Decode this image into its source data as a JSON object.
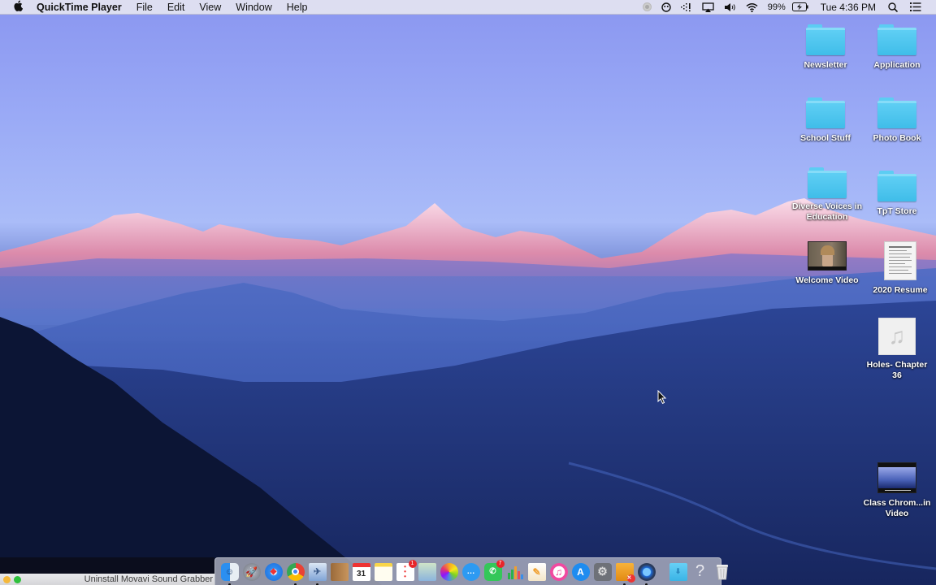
{
  "menubar": {
    "apple_icon": "apple-logo-icon",
    "app_name": "QuickTime Player",
    "menus": [
      "File",
      "Edit",
      "View",
      "Window",
      "Help"
    ],
    "status": {
      "icons": [
        "record-indicator-icon",
        "face-status-icon",
        "bluetooth-signal-icon",
        "airplay-icon",
        "volume-icon",
        "wifi-icon"
      ],
      "battery_percent": "99%",
      "battery_icon": "battery-charging-icon",
      "clock": "Tue 4:36 PM",
      "spotlight_icon": "search-icon",
      "notification_icon": "notification-center-icon"
    }
  },
  "desktop": {
    "icons": [
      {
        "label": "Newsletter",
        "type": "folder"
      },
      {
        "label": "Application",
        "type": "folder"
      },
      {
        "label": "School Stuff",
        "type": "folder"
      },
      {
        "label": "Photo Book",
        "type": "folder"
      },
      {
        "label": "Diverse Voices in Education",
        "type": "folder"
      },
      {
        "label": "TpT Store",
        "type": "folder"
      },
      {
        "label": "Welcome Video",
        "type": "video"
      },
      {
        "label": "2020 Resume",
        "type": "document"
      },
      {
        "label": "Holes- Chapter 36",
        "type": "audio"
      },
      {
        "label": "Class Chrom...in Video",
        "type": "video"
      }
    ]
  },
  "dock": {
    "apps": [
      {
        "name": "Finder",
        "icon": "finder-icon",
        "running": true
      },
      {
        "name": "Launchpad",
        "icon": "launchpad-icon",
        "running": false
      },
      {
        "name": "Safari",
        "icon": "safari-icon",
        "running": false
      },
      {
        "name": "Google Chrome",
        "icon": "chrome-icon",
        "running": true
      },
      {
        "name": "Preview",
        "icon": "preview-icon",
        "running": true
      },
      {
        "name": "Contacts",
        "icon": "contacts-icon",
        "running": false
      },
      {
        "name": "Calendar",
        "icon": "calendar-icon",
        "running": false,
        "text": "31"
      },
      {
        "name": "Notes",
        "icon": "notes-icon",
        "running": false
      },
      {
        "name": "Reminders",
        "icon": "reminders-icon",
        "running": false,
        "badge": "1"
      },
      {
        "name": "Image Capture",
        "icon": "image-capture-icon",
        "running": false
      },
      {
        "name": "Photos",
        "icon": "photos-icon",
        "running": false
      },
      {
        "name": "Messages",
        "icon": "messages-icon",
        "running": false
      },
      {
        "name": "FaceTime",
        "icon": "facetime-icon",
        "running": false,
        "badge": "7"
      },
      {
        "name": "Numbers",
        "icon": "numbers-icon",
        "running": false
      },
      {
        "name": "Pages",
        "icon": "pages-icon",
        "running": false
      },
      {
        "name": "iTunes",
        "icon": "itunes-icon",
        "running": false
      },
      {
        "name": "App Store",
        "icon": "app-store-icon",
        "running": false
      },
      {
        "name": "System Preferences",
        "icon": "system-preferences-icon",
        "running": false
      },
      {
        "name": "Uninstaller",
        "icon": "uninstaller-icon",
        "running": true
      },
      {
        "name": "QuickTime Player",
        "icon": "quicktime-icon",
        "running": true
      }
    ],
    "stacks": [
      {
        "name": "Downloads",
        "icon": "downloads-folder-icon"
      },
      {
        "name": "Help",
        "icon": "help-icon",
        "text": "?"
      },
      {
        "name": "Trash",
        "icon": "trash-icon"
      }
    ]
  },
  "window_strip": {
    "title": "Uninstall Movavi Sound Grabber",
    "buttons": [
      "minimize",
      "zoom"
    ]
  }
}
